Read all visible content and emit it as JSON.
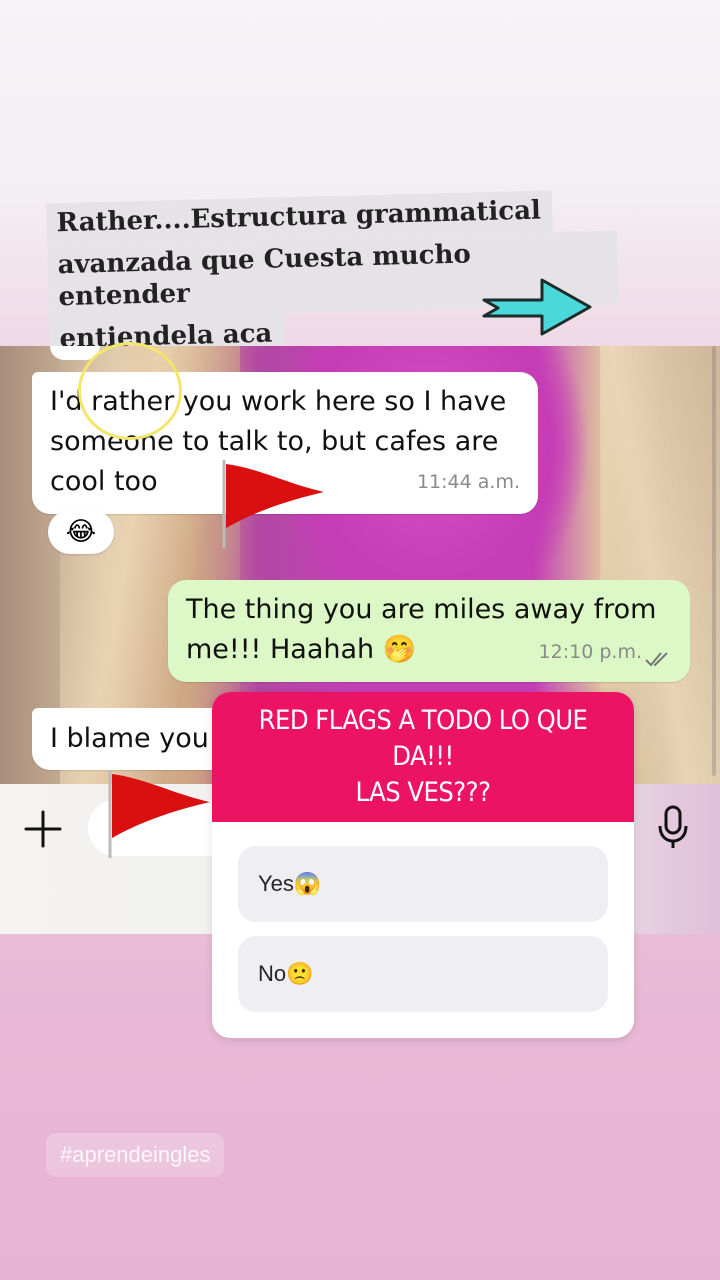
{
  "caption": {
    "lines": [
      "Rather....Estructura grammatical",
      "avanzada que Cuesta mucho entender",
      "entiendela aca"
    ]
  },
  "chat": {
    "messages": [
      {
        "direction": "in",
        "text_lines": [
          "I'd rather you work here so I have",
          "someone to talk to, but cafes are",
          "cool too"
        ],
        "time": "11:44 a.m.",
        "reaction": "😂"
      },
      {
        "direction": "out",
        "text_lines": [
          "The thing you are miles away from",
          "me!!! Haahah 🤭"
        ],
        "time": "12:10 p.m.",
        "status": "read"
      },
      {
        "direction": "in",
        "text": "I blame you"
      }
    ],
    "reaction_top": "👍"
  },
  "poll": {
    "question": "RED FLAGS A TODO LO QUE DA!!!\nLAS VES???",
    "options": [
      {
        "label": "Yes😱"
      },
      {
        "label": "No🙁"
      }
    ]
  },
  "hashtag": "#aprendeingles",
  "colors": {
    "poll_header": "#ec1264",
    "outgoing_bubble": "#dcf8c6",
    "arrow": "#4ad8db",
    "flag": "#d90f10",
    "highlight_circle": "#f2e66b"
  },
  "icons": [
    "arrow-right-icon",
    "red-flag-icon",
    "plus-icon",
    "microphone-icon",
    "double-check-icon"
  ]
}
